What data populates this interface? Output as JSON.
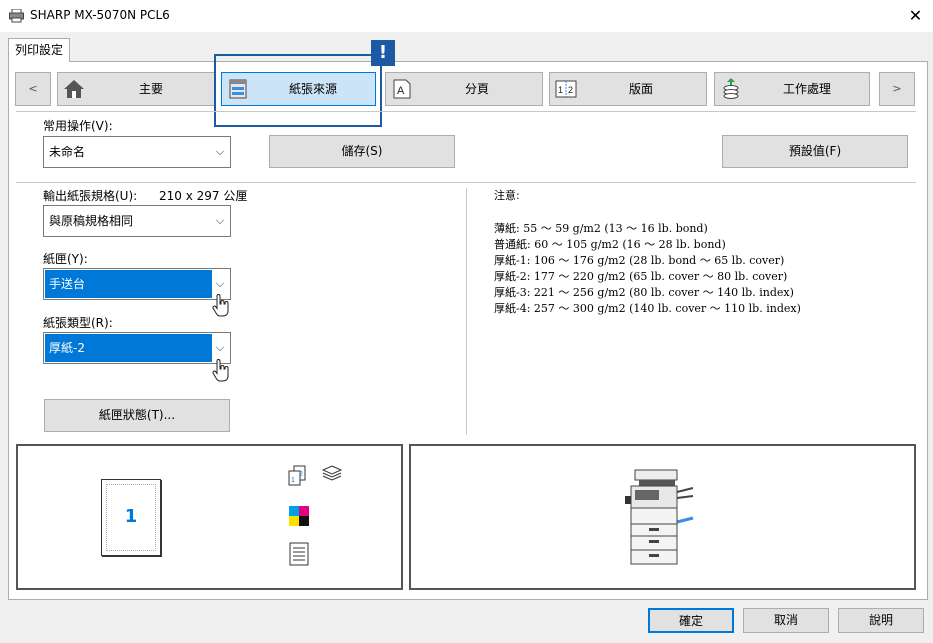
{
  "window": {
    "title": "SHARP MX-5070N PCL6",
    "close_glyph": "✕"
  },
  "tab": {
    "label": "列印設定"
  },
  "toolbar": {
    "prev_glyph": "<",
    "next_glyph": ">",
    "items": [
      {
        "label": "主要",
        "icon": "home-icon"
      },
      {
        "label": "紙張來源",
        "icon": "paper-tray-icon",
        "selected": true
      },
      {
        "label": "分頁",
        "icon": "document-icon"
      },
      {
        "label": "版面",
        "icon": "page-layout-icon"
      },
      {
        "label": "工作處理",
        "icon": "job-stack-icon"
      }
    ],
    "alert_glyph": "!"
  },
  "favorites": {
    "label": "常用操作(V):",
    "value": "未命名",
    "save_label": "儲存(S)",
    "default_label": "預設值(F)"
  },
  "paper": {
    "output_size_label": "輸出紙張規格(U):",
    "output_size_dims": "210 x 297 公厘",
    "output_size_value": "與原稿規格相同",
    "tray_label": "紙匣(Y):",
    "tray_value": "手送台",
    "type_label": "紙張類型(R):",
    "type_value": "厚紙-2",
    "tray_status_label": "紙匣狀態(T)..."
  },
  "notes": {
    "heading": "注意:",
    "lines": [
      "薄紙: 55 ～ 59 g/m2 (13 ～ 16 lb. bond)",
      "普通紙: 60 ～ 105 g/m2 (16 ～ 28 lb. bond)",
      "厚紙-1: 106 ～ 176 g/m2 (28 lb. bond ～ 65 lb. cover)",
      "厚紙-2: 177 ～ 220 g/m2 (65 lb. cover ～ 80 lb. cover)",
      "厚紙-3: 221 ～ 256 g/m2 (80 lb. cover ～ 140 lb. index)",
      "厚紙-4: 257 ～ 300 g/m2 (140 lb. cover ～ 110 lb. index)"
    ]
  },
  "preview": {
    "page_number": "1"
  },
  "buttons": {
    "ok": "確定",
    "cancel": "取消",
    "help": "說明"
  },
  "colors": {
    "accent": "#0078d7",
    "focus_border": "#1c5aa6",
    "selected_bg": "#cce4f7"
  }
}
